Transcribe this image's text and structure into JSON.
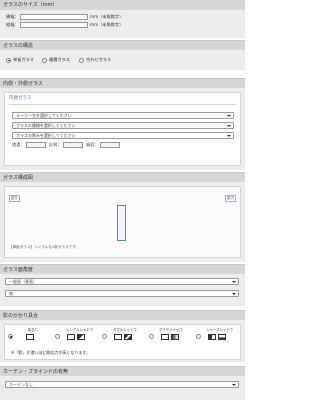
{
  "size": {
    "title": "ガラスのサイズ（mm）",
    "width_label": "横幅：",
    "height_label": "縦幅：",
    "width_value": "",
    "height_value": "",
    "unit_hint": "mm（半角数字）"
  },
  "structure": {
    "title": "ガラスの構造",
    "options": [
      "単板ガラス",
      "複層ガラス",
      "合わせガラス"
    ],
    "selected_index": 0
  },
  "inner_outer": {
    "title": "内側・外側ガラス",
    "card_title": "内側ガラス",
    "selects": [
      "メーカー名を選択してください",
      "ガラスの種類を選択してください",
      "ガラスの厚みを選択してください"
    ],
    "transmit_label": "透過：",
    "reflect_label": "反射：",
    "absorb_label": "吸収："
  },
  "diagram": {
    "title": "ガラス構成図",
    "outside_tag": "屋外",
    "inside_tag": "屋内",
    "caption": "【単板ガラス】シンプルな1枚ガラスです。"
  },
  "incidence": {
    "title": "ガラス面角度",
    "selects": [
      "一般面（垂直）",
      "南"
    ]
  },
  "shadow": {
    "title": "影のかかり具合",
    "options": [
      "影なし",
      "シングルシャドウ",
      "ダブルシャドウ",
      "グラデシャドウ",
      "シャープシャドウ"
    ],
    "selected_index": 0,
    "note": "※「影」が濃いほど熱応力が高くなります。"
  },
  "curtain": {
    "title": "カーテン・ブラインドの有無",
    "select": "カーテンなし"
  }
}
